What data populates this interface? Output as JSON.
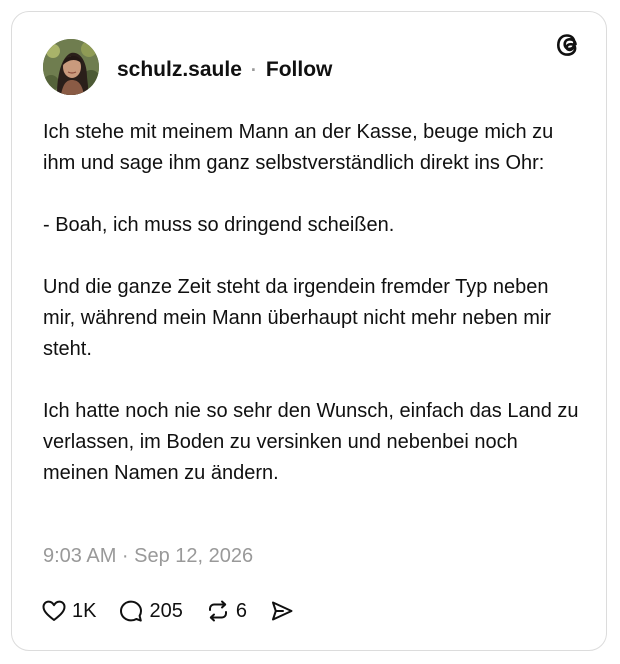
{
  "post": {
    "author": {
      "username": "schulz.saule",
      "separator": "·",
      "follow_label": "Follow"
    },
    "logo_icon": "threads-logo-icon",
    "paragraphs": [
      "Ich stehe mit meinem Mann an der Kasse, beuge mich zu ihm und sage ihm ganz selbstverständlich direkt ins Ohr:",
      "- Boah, ich muss so dringend scheißen.",
      "Und die ganze Zeit steht da irgendein fremder Typ neben mir, während mein Mann überhaupt nicht mehr neben mir steht.",
      "Ich hatte noch nie so sehr den Wunsch, einfach das Land zu verlassen, im Boden zu versinken und nebenbei noch meinen Namen zu ändern."
    ],
    "timestamp": "9:03 AM · Sep 12, 2026",
    "actions": {
      "likes": "1K",
      "replies": "205",
      "reposts": "6"
    }
  },
  "colors": {
    "text": "#101010",
    "muted": "#999999",
    "border": "#dcdcdc"
  }
}
